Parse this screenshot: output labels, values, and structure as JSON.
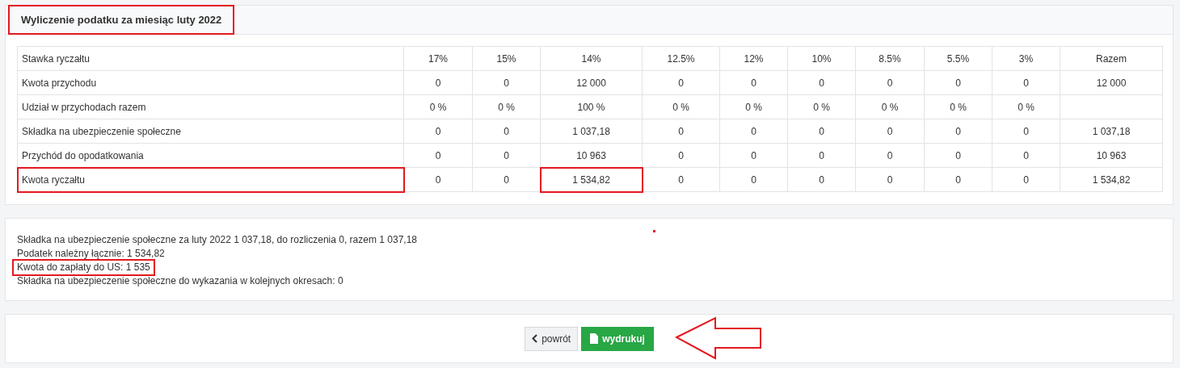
{
  "title": {
    "text": "Wyliczenie podatku za miesiąc luty 2022",
    "highlighted": true
  },
  "table": {
    "header": {
      "label": "Stawka ryczałtu",
      "cells": [
        "17%",
        "15%",
        "14%",
        "12.5%",
        "12%",
        "10%",
        "8.5%",
        "5.5%",
        "3%",
        "Razem"
      ]
    },
    "rows": [
      {
        "label": "Kwota przychodu",
        "highlighted": false,
        "cells": [
          {
            "text": "0",
            "highlighted": false
          },
          {
            "text": "0",
            "highlighted": false
          },
          {
            "text": "12 000",
            "highlighted": false
          },
          {
            "text": "0",
            "highlighted": false
          },
          {
            "text": "0",
            "highlighted": false
          },
          {
            "text": "0",
            "highlighted": false
          },
          {
            "text": "0",
            "highlighted": false
          },
          {
            "text": "0",
            "highlighted": false
          },
          {
            "text": "0",
            "highlighted": false
          },
          {
            "text": "12 000",
            "highlighted": false
          }
        ]
      },
      {
        "label": "Udział w przychodach razem",
        "highlighted": false,
        "cells": [
          {
            "text": "0 %",
            "highlighted": false
          },
          {
            "text": "0 %",
            "highlighted": false
          },
          {
            "text": "100 %",
            "highlighted": false
          },
          {
            "text": "0 %",
            "highlighted": false
          },
          {
            "text": "0 %",
            "highlighted": false
          },
          {
            "text": "0 %",
            "highlighted": false
          },
          {
            "text": "0 %",
            "highlighted": false
          },
          {
            "text": "0 %",
            "highlighted": false
          },
          {
            "text": "0 %",
            "highlighted": false
          },
          {
            "text": "",
            "highlighted": false
          }
        ]
      },
      {
        "label": "Składka na ubezpieczenie społeczne",
        "highlighted": false,
        "cells": [
          {
            "text": "0",
            "highlighted": false
          },
          {
            "text": "0",
            "highlighted": false
          },
          {
            "text": "1 037,18",
            "highlighted": false
          },
          {
            "text": "0",
            "highlighted": false
          },
          {
            "text": "0",
            "highlighted": false
          },
          {
            "text": "0",
            "highlighted": false
          },
          {
            "text": "0",
            "highlighted": false
          },
          {
            "text": "0",
            "highlighted": false
          },
          {
            "text": "0",
            "highlighted": false
          },
          {
            "text": "1 037,18",
            "highlighted": false
          }
        ]
      },
      {
        "label": "Przychód do opodatkowania",
        "highlighted": false,
        "cells": [
          {
            "text": "0",
            "highlighted": false
          },
          {
            "text": "0",
            "highlighted": false
          },
          {
            "text": "10 963",
            "highlighted": false
          },
          {
            "text": "0",
            "highlighted": false
          },
          {
            "text": "0",
            "highlighted": false
          },
          {
            "text": "0",
            "highlighted": false
          },
          {
            "text": "0",
            "highlighted": false
          },
          {
            "text": "0",
            "highlighted": false
          },
          {
            "text": "0",
            "highlighted": false
          },
          {
            "text": "10 963",
            "highlighted": false
          }
        ]
      },
      {
        "label": "Kwota ryczałtu",
        "highlighted": true,
        "cells": [
          {
            "text": "0",
            "highlighted": false
          },
          {
            "text": "0",
            "highlighted": false
          },
          {
            "text": "1 534,82",
            "highlighted": true
          },
          {
            "text": "0",
            "highlighted": false
          },
          {
            "text": "0",
            "highlighted": false
          },
          {
            "text": "0",
            "highlighted": false
          },
          {
            "text": "0",
            "highlighted": false
          },
          {
            "text": "0",
            "highlighted": false
          },
          {
            "text": "0",
            "highlighted": false
          },
          {
            "text": "1 534,82",
            "highlighted": false
          }
        ]
      }
    ]
  },
  "summary": [
    {
      "text": "Składka na ubezpieczenie społeczne za luty 2022 1 037,18, do rozliczenia 0, razem 1 037,18",
      "highlighted": false
    },
    {
      "text": "Podatek należny łącznie: 1 534,82",
      "highlighted": false
    },
    {
      "text": "Kwota do zapłaty do US: 1 535",
      "highlighted": true
    },
    {
      "text": "Składka na ubezpieczenie społeczne do wykazania w kolejnych okresach: 0",
      "highlighted": false
    }
  ],
  "buttons": [
    {
      "label": "powrót",
      "kind": "back"
    },
    {
      "label": "wydrukuj",
      "kind": "print"
    }
  ]
}
